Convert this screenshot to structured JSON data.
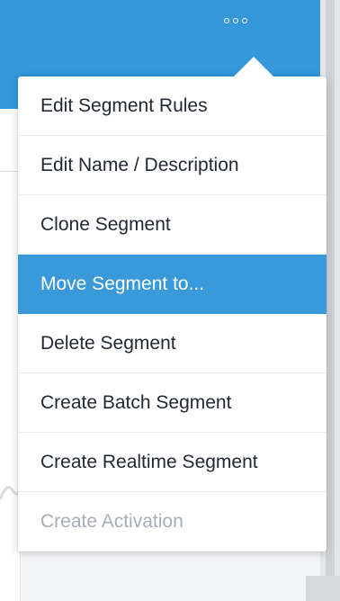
{
  "header": {
    "more_icon": "more-horizontal-icon",
    "color": "#3498db"
  },
  "menu": {
    "items": [
      {
        "label": "Edit Segment Rules",
        "state": "normal"
      },
      {
        "label": "Edit Name / Description",
        "state": "normal"
      },
      {
        "label": "Clone Segment",
        "state": "normal"
      },
      {
        "label": "Move Segment to...",
        "state": "active"
      },
      {
        "label": "Delete Segment",
        "state": "normal"
      },
      {
        "label": "Create Batch Segment",
        "state": "normal"
      },
      {
        "label": "Create Realtime Segment",
        "state": "normal"
      },
      {
        "label": "Create Activation",
        "state": "disabled"
      }
    ],
    "active_color": "#3a9ad9",
    "disabled_color": "#a7adb4"
  }
}
